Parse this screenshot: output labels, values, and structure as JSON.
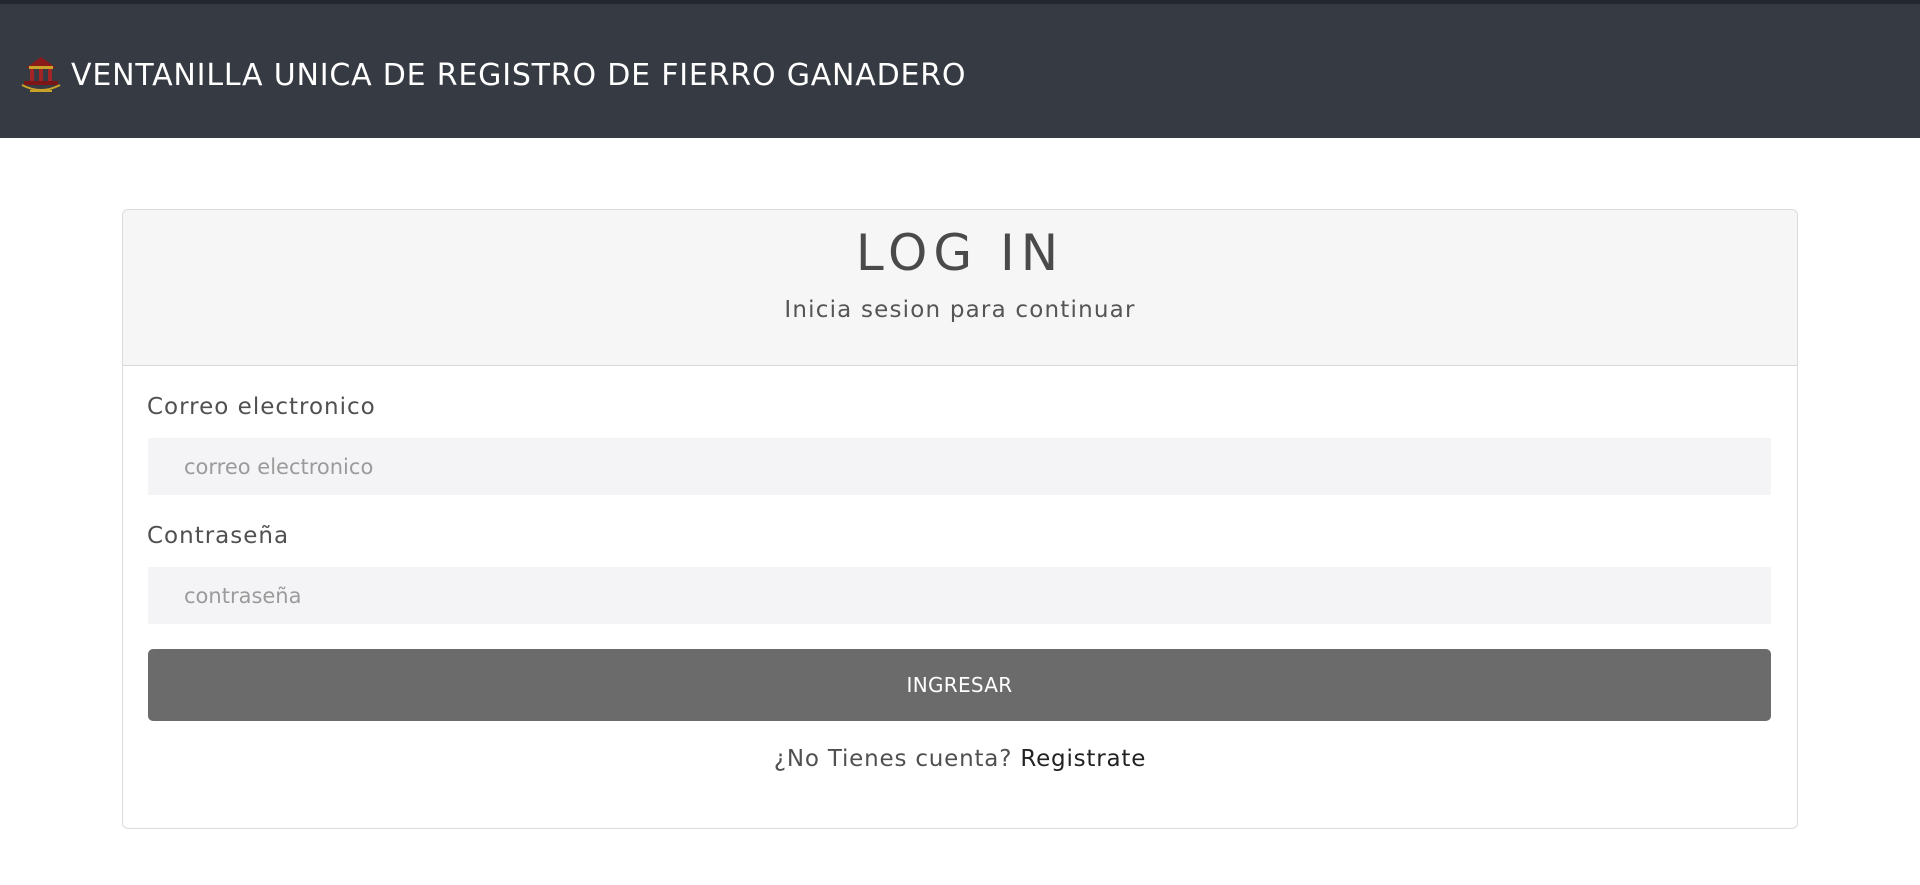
{
  "header": {
    "title": "VENTANILLA UNICA DE REGISTRO DE FIERRO GANADERO",
    "logo_icon": "institution-seal-icon",
    "background_color": "#363a42"
  },
  "login": {
    "title": "LOG IN",
    "subtitle": "Inicia sesion para continuar",
    "email": {
      "label": "Correo electronico",
      "placeholder": "correo electronico",
      "value": ""
    },
    "password": {
      "label": "Contraseña",
      "placeholder": "contraseña",
      "value": ""
    },
    "submit_label": "INGRESAR",
    "submit_color": "#6b6b6b",
    "register_prompt": "¿No Tienes cuenta?",
    "register_link": "Registrate"
  }
}
